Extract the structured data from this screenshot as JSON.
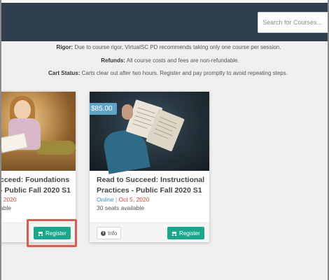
{
  "header": {
    "search": {
      "placeholder": "Search for Courses..."
    }
  },
  "notices": [
    {
      "label": "Rigor:",
      "text": " Due to course rigor, VirtualSC PD recommends taking only one course per session."
    },
    {
      "label": "Refunds:",
      "text": " All course costs and fees are non-refundable."
    },
    {
      "label": "Cart Status:",
      "text": " Carts clear out after two hours. Register and pay promptly to avoid repeating steps."
    }
  ],
  "courses": [
    {
      "title_line1": "cceed: Foundations",
      "title_line2": "- Public Fall 2020 S1",
      "mode": "",
      "date": ", 2020",
      "seats": "able",
      "register_label": "Register"
    },
    {
      "price": "$85.00",
      "title_line1": "Read to Succeed: Instructional",
      "title_line2": "Practices - Public Fall 2020 S1",
      "mode": "Online",
      "separator": "|",
      "date": "Oct 5, 2020",
      "seats": "30 seats available",
      "info_label": "Info",
      "register_label": "Register"
    }
  ],
  "colors": {
    "header": "#2f3f4e",
    "register_button": "#1aa88a",
    "price_tag": "#5fa3c9",
    "highlight": "#e05a4a"
  }
}
